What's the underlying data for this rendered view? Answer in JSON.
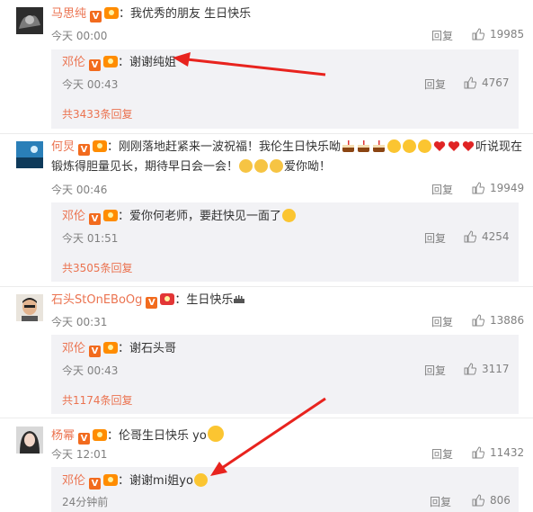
{
  "labels": {
    "reply": "回复",
    "colon": "：",
    "badge_v": "V"
  },
  "comments": [
    {
      "author": "马思纯",
      "text": "我优秀的朋友 生日快乐",
      "time": "今天 00:00",
      "likes": "19985",
      "reply": {
        "author": "邓伦",
        "text": "谢谢纯姐",
        "time": "今天 00:43",
        "likes": "4767"
      },
      "more": "共3433条回复"
    },
    {
      "author": "何炅",
      "text_line1": "刚刚落地赶紧来一波祝福！我伦生日快乐呦",
      "text_line1_end": "听说现在",
      "text_line2": "锻炼得胆量见长，期待早日会一会！",
      "text_line2_end": "爱你呦！",
      "time": "今天 00:46",
      "likes": "19949",
      "reply": {
        "author": "邓伦",
        "text": "爱你何老师，要赶快见一面了",
        "time": "今天 01:51",
        "likes": "4254"
      },
      "more": "共3505条回复"
    },
    {
      "author": "石头StOnEBoOg",
      "text": "生日快乐",
      "time": "今天 00:31",
      "likes": "13886",
      "reply": {
        "author": "邓伦",
        "text": "谢石头哥",
        "time": "今天 00:43",
        "likes": "3117"
      },
      "more": "共1174条回复"
    },
    {
      "author": "杨幂",
      "text": "伦哥生日快乐 yo",
      "time": "今天 12:01",
      "likes": "11432",
      "reply": {
        "author": "邓伦",
        "text": "谢谢mi姐yo",
        "time": "24分钟前",
        "likes": "806"
      }
    }
  ],
  "colors": {
    "name": "#eb7350",
    "meta": "#808080",
    "reply_bg": "#f2f2f5",
    "arrow": "#e8231e"
  }
}
